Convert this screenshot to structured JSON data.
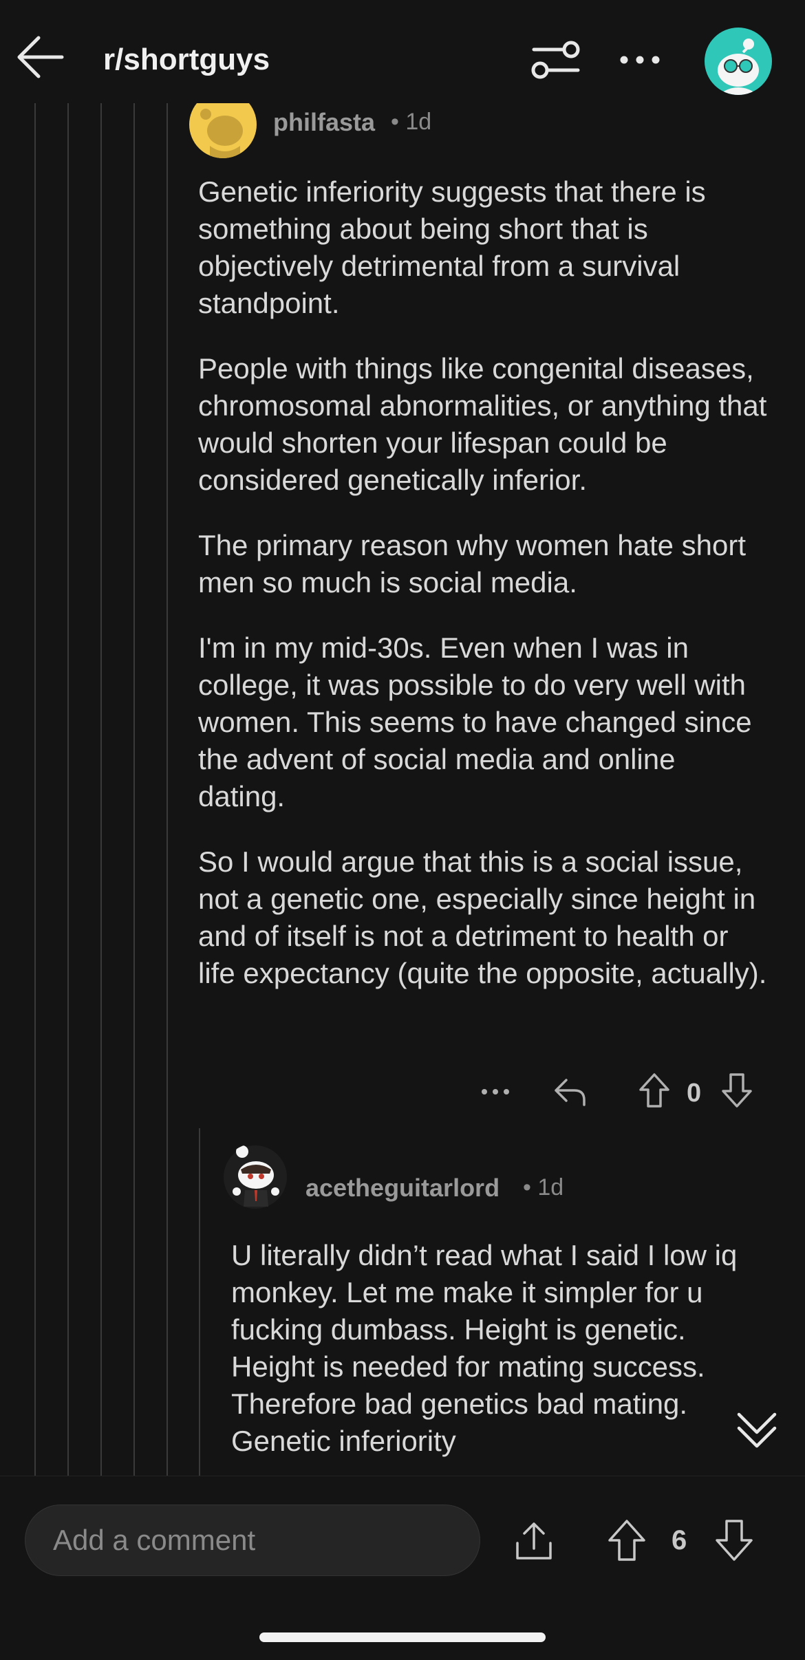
{
  "header": {
    "title": "r/shortguys"
  },
  "comments": [
    {
      "username": "philfasta",
      "time": "1d",
      "paragraphs": [
        "Genetic inferiority suggests that there is something about being short that is objectively detrimental from a survival standpoint.",
        "People with things like congenital diseases, chromosomal abnormalities, or anything that would shorten your lifespan could be considered genetically inferior.",
        "The primary reason why women hate short men so much is social media.",
        "I'm in my mid-30s. Even when I was in college, it was possible to do very well with women. This seems to have changed since the advent of social media and online dating.",
        "So I would argue that this is a social issue, not a genetic one, especially since height in and of itself is not a detriment to health or life expectancy (quite the opposite, actually)."
      ],
      "vote_count": "0"
    },
    {
      "username": "acetheguitarlord",
      "time": "1d",
      "paragraphs": [
        "U literally didn’t read what I said I low iq monkey. Let me make it simpler for u fucking dumbass. Height is genetic. Height is needed for mating success. Therefore bad genetics bad mating. Genetic inferiority"
      ]
    }
  ],
  "bottom_bar": {
    "comment_placeholder": "Add a comment",
    "post_vote_count": "6"
  },
  "colors": {
    "background": "#141414",
    "text": "#d9d9d9",
    "muted": "#9a9a9a",
    "avatar_teal": "#2fc7b8",
    "avatar_yellow": "#f2c94c"
  },
  "icons": [
    "back-arrow-icon",
    "filter-icon",
    "more-icon",
    "user-avatar-icon",
    "reply-icon",
    "upvote-icon",
    "downvote-icon",
    "share-icon",
    "chevron-double-down-icon"
  ]
}
